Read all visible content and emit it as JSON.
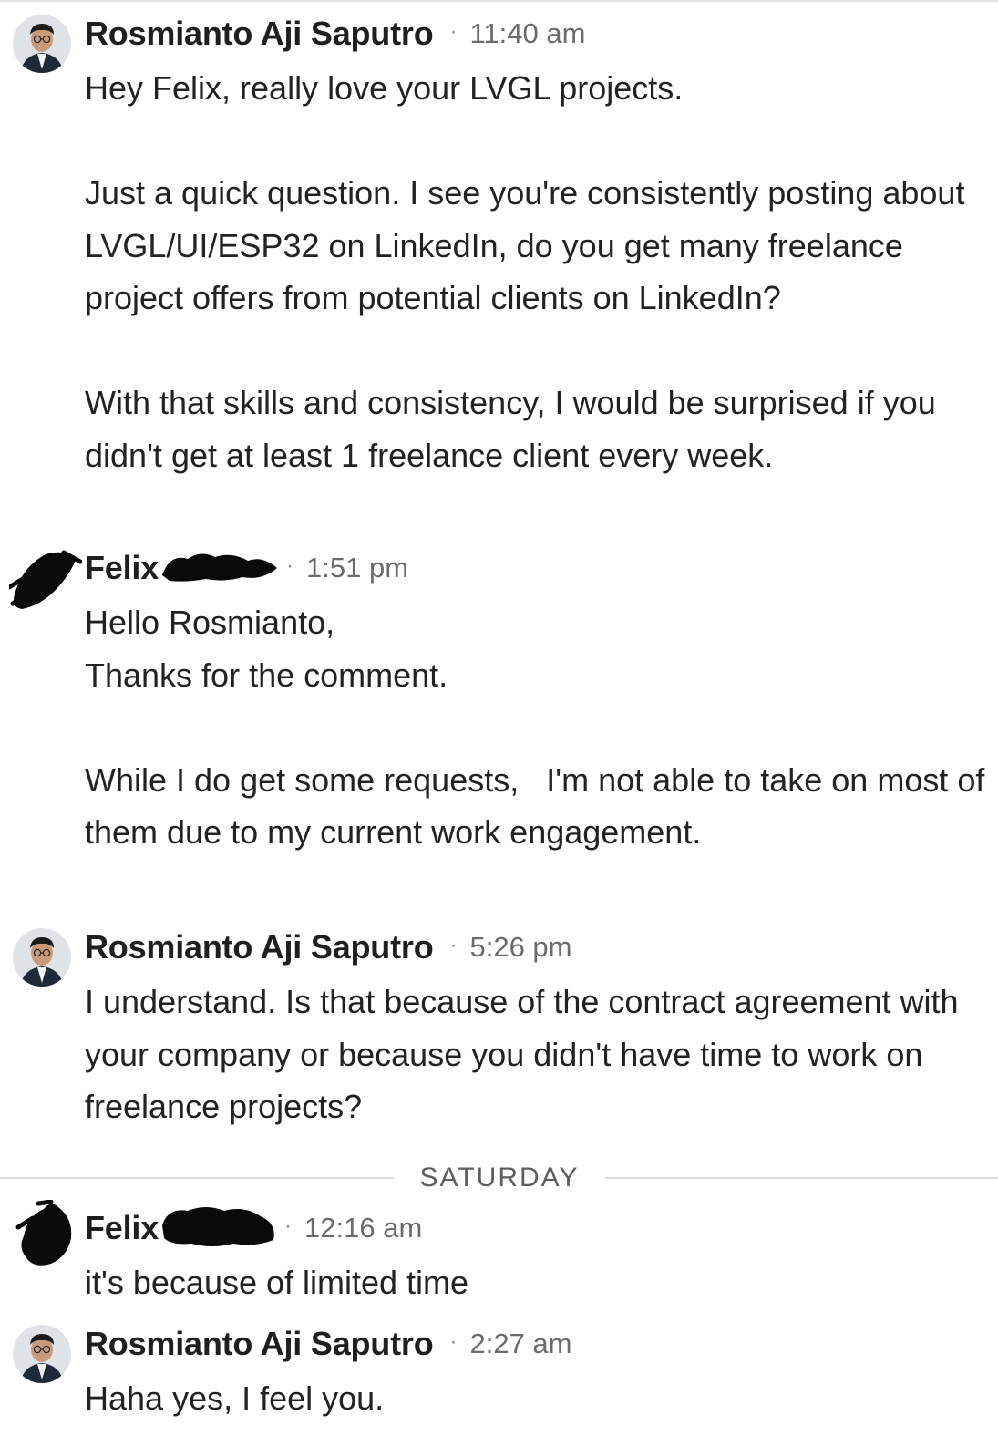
{
  "messages": [
    {
      "sender": "Rosmianto Aji Saputro",
      "time": "11:40 am",
      "text": "Hey Felix, really love your LVGL projects.\n\nJust a quick question. I see you're consistently posting about LVGL/UI/ESP32 on LinkedIn, do you get many freelance project offers from potential clients on LinkedIn?\n\nWith that skills and consistency, I would be surprised if you didn't get at least 1 freelance client every week."
    },
    {
      "sender": "Felix",
      "time": "1:51 pm",
      "text": "Hello Rosmianto,\nThanks for the comment.\n\nWhile I do get some requests,   I'm not able to take on most of them due to my current work engagement."
    },
    {
      "sender": "Rosmianto Aji Saputro",
      "time": "5:26 pm",
      "text": "I understand. Is that because of the contract agreement with your company or because you didn't have time to work on freelance projects?"
    },
    {
      "sender": "Felix",
      "time": "12:16 am",
      "text": "it's because of limited time"
    },
    {
      "sender": "Rosmianto Aji Saputro",
      "time": "2:27 am",
      "text": "Haha yes, I feel you."
    }
  ],
  "day_divider": "SATURDAY",
  "separator": "·"
}
